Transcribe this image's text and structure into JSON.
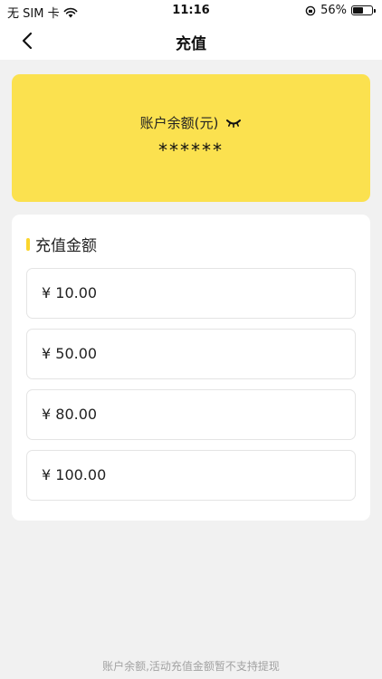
{
  "status_bar": {
    "carrier": "无 SIM 卡",
    "time": "11:16",
    "battery_percent": "56%",
    "battery_level": 0.56,
    "icons": [
      "wifi-icon",
      "rotation-lock-icon",
      "battery-icon"
    ]
  },
  "nav": {
    "title": "充值",
    "back_icon": "chevron-left-icon"
  },
  "balance": {
    "label": "账户余额(元)",
    "masked_value": "******",
    "visibility_icon": "eye-closed-icon"
  },
  "recharge": {
    "section_title": "充值金额",
    "options": [
      {
        "label": "¥ 10.00"
      },
      {
        "label": "¥ 50.00"
      },
      {
        "label": "¥ 80.00"
      },
      {
        "label": "¥ 100.00"
      }
    ]
  },
  "footer": {
    "note": "账户余额,活动充值金额暂不支持提现"
  },
  "colors": {
    "accent": "#fbe14f",
    "section_bar": "#fbd52c",
    "page_bg": "#f1f1f1"
  }
}
